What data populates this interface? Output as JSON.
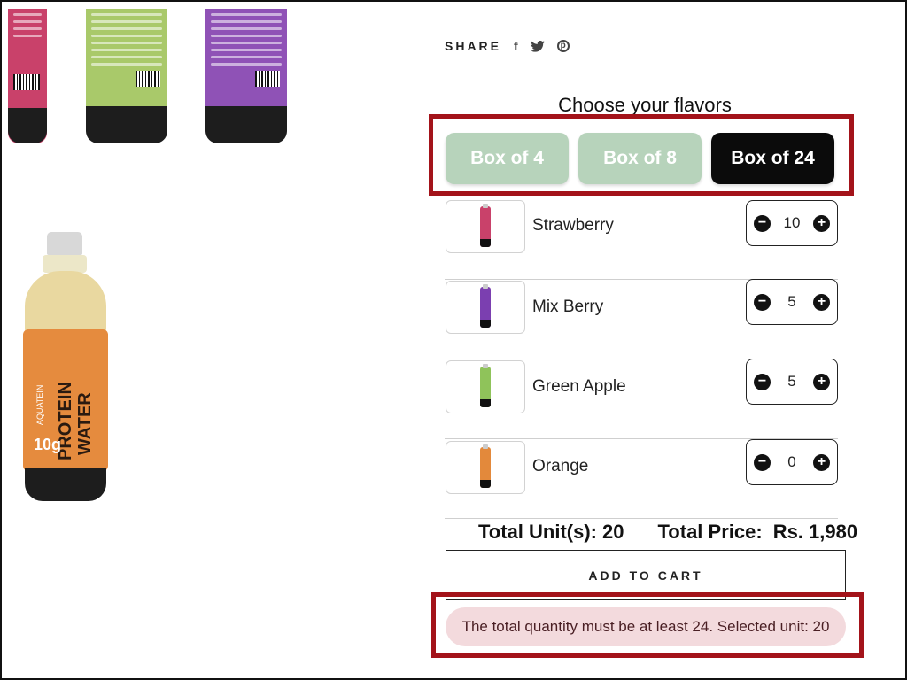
{
  "share": {
    "label": "SHARE",
    "icons": [
      "facebook-icon",
      "twitter-icon",
      "pinterest-icon"
    ]
  },
  "heading": "Choose your flavors",
  "tabs": [
    {
      "label": "Box of 4",
      "active": false
    },
    {
      "label": "Box of 8",
      "active": false
    },
    {
      "label": "Box of 24",
      "active": true
    }
  ],
  "flavors": [
    {
      "name": "Strawberry",
      "qty": "10",
      "color": "#c9416a"
    },
    {
      "name": "Mix Berry",
      "qty": "5",
      "color": "#7b3fb0"
    },
    {
      "name": "Green Apple",
      "qty": "5",
      "color": "#8fc35a"
    },
    {
      "name": "Orange",
      "qty": "0",
      "color": "#e3893b"
    }
  ],
  "stepper": {
    "minus": "−",
    "plus": "+"
  },
  "totals": {
    "units_label": "Total Unit(s):",
    "units_value": "20",
    "price_label": "Total Price:",
    "price_value": "Rs. 1,980"
  },
  "add_to_cart": "ADD TO CART",
  "error_message": "The total quantity must be at least 24. Selected unit: 20",
  "product_image": {
    "brand": "AQUATEIN",
    "line1": "PROTEIN",
    "line2": "WATER",
    "protein": "10g"
  },
  "colors": {
    "tab_inactive": "#b7d3bb",
    "tab_active": "#0b0b0b",
    "highlight": "#a3131a",
    "error_bg": "#f3dadd"
  }
}
